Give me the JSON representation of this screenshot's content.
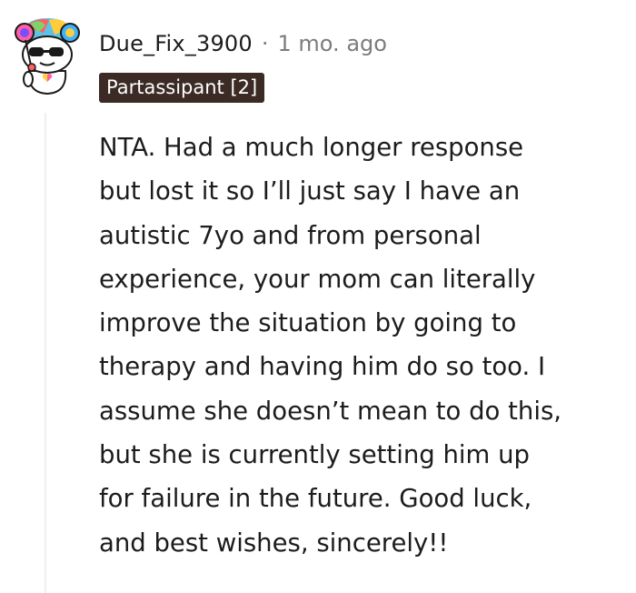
{
  "comment": {
    "username": "Due_Fix_3900",
    "separator": "·",
    "timestamp": "1 mo. ago",
    "flair": "Partassipant [2]",
    "body": "NTA. Had a much longer response\nbut lost it so I’ll just say I have an\nautistic 7yo and from personal\nexperience, your mom can literally\nimprove the situation by going to\ntherapy and having him do so too. I\nassume she doesn’t mean to do this,\nbut she is currently setting him up\nfor failure in the future. Good luck,\nand best wishes, sincerely!!"
  },
  "colors": {
    "flair_background": "#3b2b24",
    "flair_text": "#ffffff",
    "meta_gray": "#7c7c7c",
    "thread_line": "#edeff1"
  },
  "icons": {
    "avatar": "snoo-avatar-icon"
  }
}
